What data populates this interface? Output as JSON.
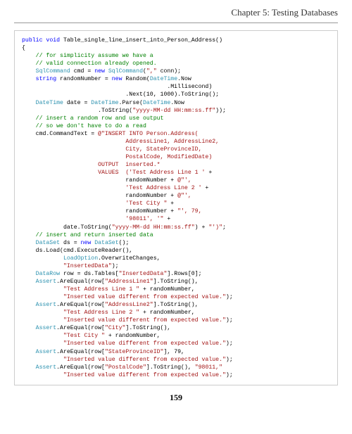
{
  "chapter_title": "Chapter 5: Testing Databases",
  "page_number": "159",
  "code": {
    "l01a": "public",
    "l01b": " ",
    "l01c": "void",
    "l01d": " Table_single_line_insert_into_Person_Address()",
    "l02": "{",
    "l03": "    // for simplicity assume we have a",
    "l04": "    // valid connection already opened.",
    "l05a": "    ",
    "l05b": "SqlCommand",
    "l05c": " cmd = ",
    "l05d": "new",
    "l05e": " ",
    "l05f": "SqlCommand",
    "l05g": "(",
    "l05h": "\",\"",
    "l05i": " conn);",
    "l06a": "    ",
    "l06b": "string",
    "l06c": " randomNumber = ",
    "l06d": "new",
    "l06e": " Random(",
    "l06f": "DateTime",
    "l06g": ".Now",
    "l07": "                                          .Millisecond)",
    "l08a": "                              .Next(",
    "l08b": "10",
    "l08c": ", ",
    "l08d": "1000",
    "l08e": ").ToString();",
    "l09a": "    ",
    "l09b": "DateTime",
    "l09c": " date = ",
    "l09d": "DateTime",
    "l09e": ".Parse(",
    "l09f": "DateTime",
    "l09g": ".Now",
    "l10a": "                      .ToString(",
    "l10b": "\"yyyy-MM-dd HH:mm:ss.ff\"",
    "l10c": "));",
    "l11": "    // insert a random row and use output",
    "l12": "    // so we don't have to do a read",
    "l13a": "    cmd.CommandText = ",
    "l13b": "@\"INSERT INTO Person.Address(",
    "l14": "                              AddressLine1, AddressLine2,",
    "l15": "                              City, StateProvinceID,",
    "l16": "                              PostalCode, ModifiedDate)",
    "l17": "                      OUTPUT  inserted.*",
    "l18": "                      VALUES  ('Test Address Line 1 '",
    "l18b": " +",
    "l19a": "                              randomNumber + ",
    "l19b": "@\"',",
    "l20": "                              'Test Address Line 2 '",
    "l20b": " +",
    "l21a": "                              randomNumber + ",
    "l21b": "@\"',",
    "l22": "                              'Test City \"",
    "l22b": " +",
    "l23a": "                              randomNumber + ",
    "l23b": "\"', 79,",
    "l24": "                              '98011', '\"",
    "l24b": " +",
    "l25a": "            date.ToString(",
    "l25b": "\"yyyy-MM-dd HH:mm:ss.ff\"",
    "l25c": ") + ",
    "l25d": "\"')\"",
    "l25e": ";",
    "l26": "    // insert and return inserted data",
    "l27a": "    ",
    "l27b": "DataSet",
    "l27c": " ds = ",
    "l27d": "new",
    "l27e": " ",
    "l27f": "DataSet",
    "l27g": "();",
    "l28": "    ds.Load(cmd.ExecuteReader(),",
    "l29a": "            ",
    "l29b": "LoadOption",
    "l29c": ".OverwriteChanges,",
    "l30a": "            ",
    "l30b": "\"InsertedData\"",
    "l30c": ");",
    "l31a": "    ",
    "l31b": "DataRow",
    "l31c": " row = ds.Tables[",
    "l31d": "\"InsertedData\"",
    "l31e": "].Rows[",
    "l31f": "0",
    "l31g": "];",
    "l32a": "    ",
    "l32b": "Assert",
    "l32c": ".AreEqual(row[",
    "l32d": "\"AddressLine1\"",
    "l32e": "].ToString(),",
    "l33a": "            ",
    "l33b": "\"Test Address Line 1 \"",
    "l33c": " + randomNumber,",
    "l34a": "            ",
    "l34b": "\"Inserted value different from expected value.\"",
    "l34c": ");",
    "l35a": "    ",
    "l35b": "Assert",
    "l35c": ".AreEqual(row[",
    "l35d": "\"AddressLine2\"",
    "l35e": "].ToString(),",
    "l36a": "            ",
    "l36b": "\"Test Address Line 2 \"",
    "l36c": " + randomNumber,",
    "l37a": "            ",
    "l37b": "\"Inserted value different from expected value.\"",
    "l37c": ");",
    "l38a": "    ",
    "l38b": "Assert",
    "l38c": ".AreEqual(row[",
    "l38d": "\"City\"",
    "l38e": "].ToString(),",
    "l39a": "            ",
    "l39b": "\"Test City \"",
    "l39c": " + randomNumber,",
    "l40a": "            ",
    "l40b": "\"Inserted value different from expected value.\"",
    "l40c": ");",
    "l41a": "    ",
    "l41b": "Assert",
    "l41c": ".AreEqual(row[",
    "l41d": "\"StateProvinceID\"",
    "l41e": "], ",
    "l41f": "79",
    "l41g": ",",
    "l42a": "            ",
    "l42b": "\"Inserted value different from expected value.\"",
    "l42c": ");",
    "l43a": "    ",
    "l43b": "Assert",
    "l43c": ".AreEqual(row[",
    "l43d": "\"PostalCode\"",
    "l43e": "].ToString(), ",
    "l43f": "\"98011,\"",
    "l44a": "            ",
    "l44b": "\"Inserted value different from expected value.\"",
    "l44c": ");"
  }
}
